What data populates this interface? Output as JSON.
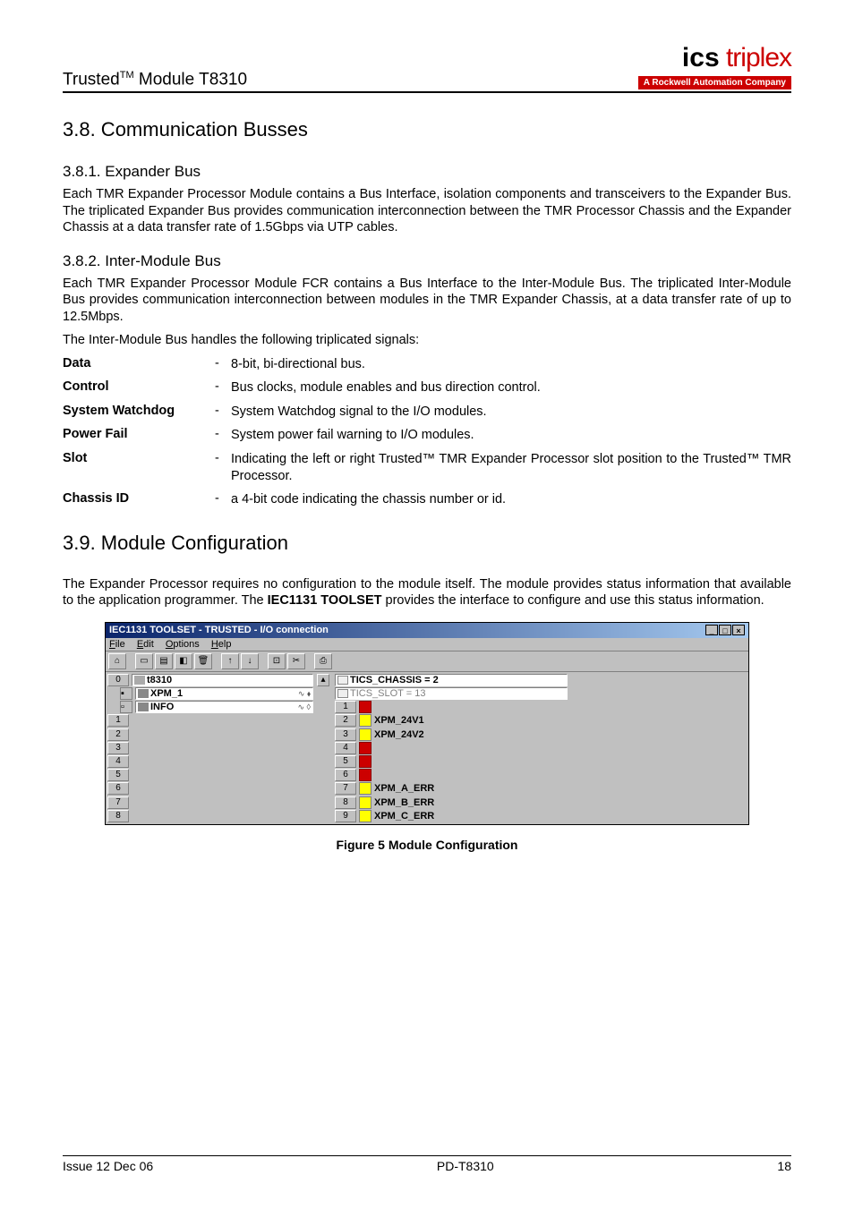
{
  "header": {
    "left_prefix": "Trusted",
    "left_tm": "TM",
    "left_suffix": " Module T8310",
    "logo_bold": "ics",
    "logo_light": " triplex",
    "logo_sub_pre": "A ",
    "logo_sub_bold": "Rockwell Automation",
    "logo_sub_post": " Company"
  },
  "s38": {
    "title": "3.8. Communication Busses",
    "s381": {
      "title": "3.8.1.  Expander Bus",
      "p1": "Each TMR Expander Processor Module contains a Bus Interface, isolation components and transceivers to the Expander Bus.  The triplicated Expander Bus provides communication interconnection between the TMR Processor Chassis and the Expander Chassis at a data transfer rate of 1.5Gbps via UTP cables."
    },
    "s382": {
      "title": "3.8.2.  Inter-Module Bus",
      "p1": "Each TMR Expander Processor Module FCR contains a Bus Interface to the Inter-Module Bus.  The triplicated Inter-Module Bus provides communication interconnection between modules in the TMR Expander Chassis, at a data transfer rate of up to 12.5Mbps.",
      "p2": "The Inter-Module Bus handles the following triplicated signals:",
      "signals": [
        {
          "label": "Data",
          "desc": "8-bit, bi-directional bus."
        },
        {
          "label": "Control",
          "desc": "Bus clocks, module enables and bus direction control."
        },
        {
          "label": "System Watchdog",
          "desc": "System Watchdog signal to the I/O modules."
        },
        {
          "label": "Power Fail",
          "desc": "System power fail warning to I/O modules."
        },
        {
          "label": "Slot",
          "desc": "Indicating the left or right Trusted™ TMR Expander Processor slot position to the Trusted™ TMR Processor."
        },
        {
          "label": "Chassis ID",
          "desc": "a 4-bit code indicating the chassis number or id."
        }
      ]
    }
  },
  "s39": {
    "title": "3.9. Module Configuration",
    "p1_a": "The Expander Processor requires no configuration to the module itself.  The module provides status information that available to the application programmer.  The ",
    "p1_bold": "IEC1131 TOOLSET",
    "p1_b": " provides the interface to configure and use this status information."
  },
  "screenshot": {
    "title": "IEC1131 TOOLSET - TRUSTED - I/O connection",
    "menu": {
      "file": "File",
      "edit": "Edit",
      "options": "Options",
      "help": "Help"
    },
    "left": {
      "row0": "t8310",
      "row0b_a": "XPM_1",
      "row0b_b": "INFO"
    },
    "right": {
      "head1": "TICS_CHASSIS = 2",
      "head2": "TICS_SLOT = 13",
      "r2": "XPM_24V1",
      "r3": "XPM_24V2",
      "r7": "XPM_A_ERR",
      "r8": "XPM_B_ERR",
      "r9": "XPM_C_ERR"
    }
  },
  "fig_caption": "Figure 5 Module Configuration",
  "footer": {
    "left": "Issue 12 Dec 06",
    "center": "PD-T8310",
    "right": "18"
  }
}
